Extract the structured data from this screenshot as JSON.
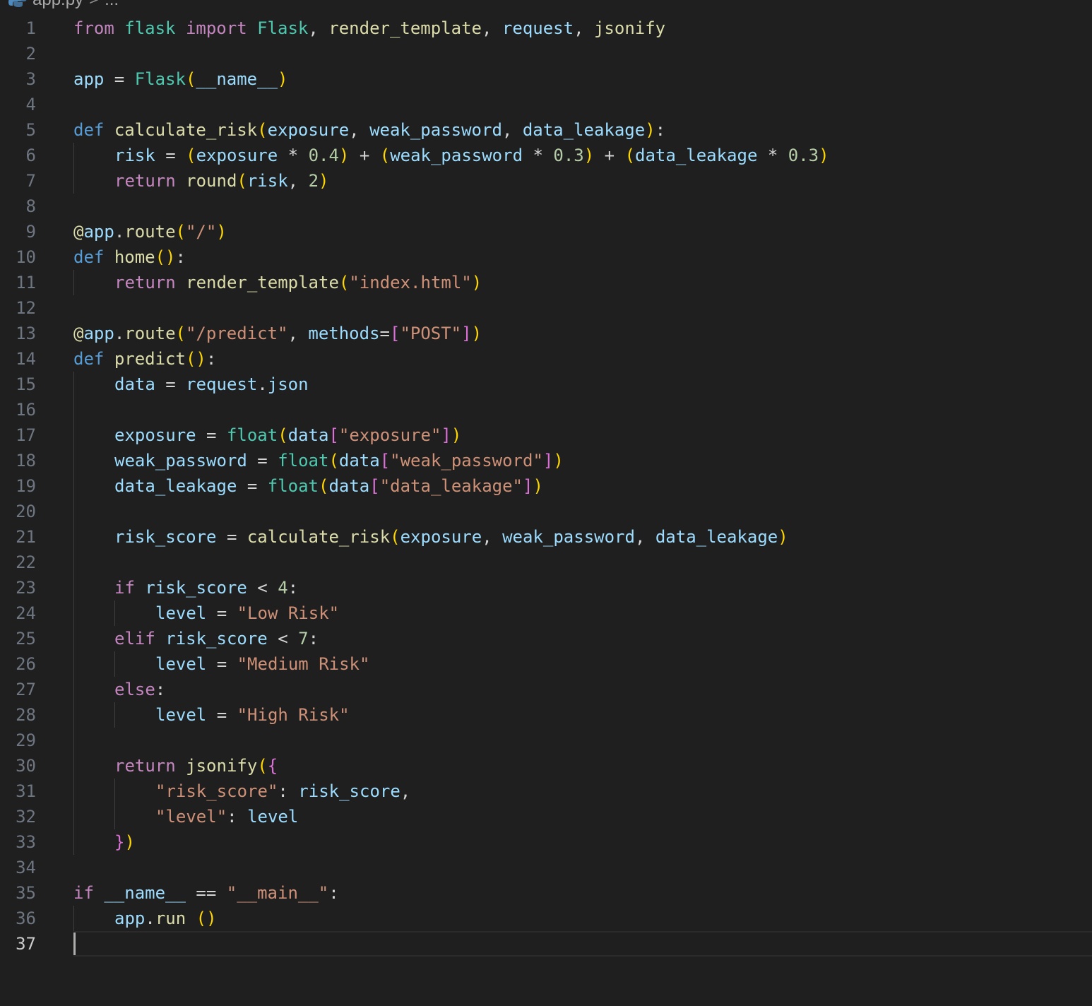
{
  "breadcrumb": {
    "file": "app.py",
    "separator": ">",
    "more": "..."
  },
  "editor": {
    "current_line": 37,
    "lines": [
      {
        "n": "1",
        "indent": 0,
        "tokens": [
          [
            "kw",
            "from"
          ],
          [
            "op",
            " "
          ],
          [
            "cls",
            "flask"
          ],
          [
            "op",
            " "
          ],
          [
            "kw",
            "import"
          ],
          [
            "op",
            " "
          ],
          [
            "cls",
            "Flask"
          ],
          [
            "op",
            ", "
          ],
          [
            "fn",
            "render_template"
          ],
          [
            "op",
            ", "
          ],
          [
            "var",
            "request"
          ],
          [
            "op",
            ", "
          ],
          [
            "fn",
            "jsonify"
          ]
        ]
      },
      {
        "n": "2",
        "indent": 0,
        "tokens": []
      },
      {
        "n": "3",
        "indent": 0,
        "tokens": [
          [
            "var",
            "app"
          ],
          [
            "op",
            " = "
          ],
          [
            "cls",
            "Flask"
          ],
          [
            "b1",
            "("
          ],
          [
            "var",
            "__name__"
          ],
          [
            "b1",
            ")"
          ]
        ]
      },
      {
        "n": "4",
        "indent": 0,
        "tokens": []
      },
      {
        "n": "5",
        "indent": 0,
        "tokens": [
          [
            "def",
            "def"
          ],
          [
            "op",
            " "
          ],
          [
            "fn",
            "calculate_risk"
          ],
          [
            "b1",
            "("
          ],
          [
            "var",
            "exposure"
          ],
          [
            "op",
            ", "
          ],
          [
            "var",
            "weak_password"
          ],
          [
            "op",
            ", "
          ],
          [
            "var",
            "data_leakage"
          ],
          [
            "b1",
            ")"
          ],
          [
            "op",
            ":"
          ]
        ]
      },
      {
        "n": "6",
        "indent": 1,
        "tokens": [
          [
            "var",
            "risk"
          ],
          [
            "op",
            " = "
          ],
          [
            "b1",
            "("
          ],
          [
            "var",
            "exposure"
          ],
          [
            "op",
            " * "
          ],
          [
            "num",
            "0.4"
          ],
          [
            "b1",
            ")"
          ],
          [
            "op",
            " + "
          ],
          [
            "b1",
            "("
          ],
          [
            "var",
            "weak_password"
          ],
          [
            "op",
            " * "
          ],
          [
            "num",
            "0.3"
          ],
          [
            "b1",
            ")"
          ],
          [
            "op",
            " + "
          ],
          [
            "b1",
            "("
          ],
          [
            "var",
            "data_leakage"
          ],
          [
            "op",
            " * "
          ],
          [
            "num",
            "0.3"
          ],
          [
            "b1",
            ")"
          ]
        ]
      },
      {
        "n": "7",
        "indent": 1,
        "tokens": [
          [
            "kw",
            "return"
          ],
          [
            "op",
            " "
          ],
          [
            "fn",
            "round"
          ],
          [
            "b1",
            "("
          ],
          [
            "var",
            "risk"
          ],
          [
            "op",
            ", "
          ],
          [
            "num",
            "2"
          ],
          [
            "b1",
            ")"
          ]
        ]
      },
      {
        "n": "8",
        "indent": 0,
        "tokens": []
      },
      {
        "n": "9",
        "indent": 0,
        "tokens": [
          [
            "fn",
            "@"
          ],
          [
            "var",
            "app"
          ],
          [
            "op",
            "."
          ],
          [
            "fn",
            "route"
          ],
          [
            "b1",
            "("
          ],
          [
            "str",
            "\"/\""
          ],
          [
            "b1",
            ")"
          ]
        ]
      },
      {
        "n": "10",
        "indent": 0,
        "tokens": [
          [
            "def",
            "def"
          ],
          [
            "op",
            " "
          ],
          [
            "fn",
            "home"
          ],
          [
            "b1",
            "()"
          ],
          [
            "op",
            ":"
          ]
        ]
      },
      {
        "n": "11",
        "indent": 1,
        "tokens": [
          [
            "kw",
            "return"
          ],
          [
            "op",
            " "
          ],
          [
            "fn",
            "render_template"
          ],
          [
            "b1",
            "("
          ],
          [
            "str",
            "\"index.html\""
          ],
          [
            "b1",
            ")"
          ]
        ]
      },
      {
        "n": "12",
        "indent": 0,
        "tokens": []
      },
      {
        "n": "13",
        "indent": 0,
        "tokens": [
          [
            "fn",
            "@"
          ],
          [
            "var",
            "app"
          ],
          [
            "op",
            "."
          ],
          [
            "fn",
            "route"
          ],
          [
            "b1",
            "("
          ],
          [
            "str",
            "\"/predict\""
          ],
          [
            "op",
            ", "
          ],
          [
            "var",
            "methods"
          ],
          [
            "op",
            "="
          ],
          [
            "b2",
            "["
          ],
          [
            "str",
            "\"POST\""
          ],
          [
            "b2",
            "]"
          ],
          [
            "b1",
            ")"
          ]
        ]
      },
      {
        "n": "14",
        "indent": 0,
        "tokens": [
          [
            "def",
            "def"
          ],
          [
            "op",
            " "
          ],
          [
            "fn",
            "predict"
          ],
          [
            "b1",
            "()"
          ],
          [
            "op",
            ":"
          ]
        ]
      },
      {
        "n": "15",
        "indent": 1,
        "tokens": [
          [
            "var",
            "data"
          ],
          [
            "op",
            " = "
          ],
          [
            "var",
            "request"
          ],
          [
            "op",
            "."
          ],
          [
            "var",
            "json"
          ]
        ]
      },
      {
        "n": "16",
        "indent": 1,
        "tokens": []
      },
      {
        "n": "17",
        "indent": 1,
        "tokens": [
          [
            "var",
            "exposure"
          ],
          [
            "op",
            " = "
          ],
          [
            "cls",
            "float"
          ],
          [
            "b1",
            "("
          ],
          [
            "var",
            "data"
          ],
          [
            "b2",
            "["
          ],
          [
            "str",
            "\"exposure\""
          ],
          [
            "b2",
            "]"
          ],
          [
            "b1",
            ")"
          ]
        ]
      },
      {
        "n": "18",
        "indent": 1,
        "tokens": [
          [
            "var",
            "weak_password"
          ],
          [
            "op",
            " = "
          ],
          [
            "cls",
            "float"
          ],
          [
            "b1",
            "("
          ],
          [
            "var",
            "data"
          ],
          [
            "b2",
            "["
          ],
          [
            "str",
            "\"weak_password\""
          ],
          [
            "b2",
            "]"
          ],
          [
            "b1",
            ")"
          ]
        ]
      },
      {
        "n": "19",
        "indent": 1,
        "tokens": [
          [
            "var",
            "data_leakage"
          ],
          [
            "op",
            " = "
          ],
          [
            "cls",
            "float"
          ],
          [
            "b1",
            "("
          ],
          [
            "var",
            "data"
          ],
          [
            "b2",
            "["
          ],
          [
            "str",
            "\"data_leakage\""
          ],
          [
            "b2",
            "]"
          ],
          [
            "b1",
            ")"
          ]
        ]
      },
      {
        "n": "20",
        "indent": 1,
        "tokens": []
      },
      {
        "n": "21",
        "indent": 1,
        "tokens": [
          [
            "var",
            "risk_score"
          ],
          [
            "op",
            " = "
          ],
          [
            "fn",
            "calculate_risk"
          ],
          [
            "b1",
            "("
          ],
          [
            "var",
            "exposure"
          ],
          [
            "op",
            ", "
          ],
          [
            "var",
            "weak_password"
          ],
          [
            "op",
            ", "
          ],
          [
            "var",
            "data_leakage"
          ],
          [
            "b1",
            ")"
          ]
        ]
      },
      {
        "n": "22",
        "indent": 1,
        "tokens": []
      },
      {
        "n": "23",
        "indent": 1,
        "tokens": [
          [
            "kw",
            "if"
          ],
          [
            "op",
            " "
          ],
          [
            "var",
            "risk_score"
          ],
          [
            "op",
            " < "
          ],
          [
            "num",
            "4"
          ],
          [
            "op",
            ":"
          ]
        ]
      },
      {
        "n": "24",
        "indent": 2,
        "tokens": [
          [
            "var",
            "level"
          ],
          [
            "op",
            " = "
          ],
          [
            "str",
            "\"Low Risk\""
          ]
        ]
      },
      {
        "n": "25",
        "indent": 1,
        "tokens": [
          [
            "kw",
            "elif"
          ],
          [
            "op",
            " "
          ],
          [
            "var",
            "risk_score"
          ],
          [
            "op",
            " < "
          ],
          [
            "num",
            "7"
          ],
          [
            "op",
            ":"
          ]
        ]
      },
      {
        "n": "26",
        "indent": 2,
        "tokens": [
          [
            "var",
            "level"
          ],
          [
            "op",
            " = "
          ],
          [
            "str",
            "\"Medium Risk\""
          ]
        ]
      },
      {
        "n": "27",
        "indent": 1,
        "tokens": [
          [
            "kw",
            "else"
          ],
          [
            "op",
            ":"
          ]
        ]
      },
      {
        "n": "28",
        "indent": 2,
        "tokens": [
          [
            "var",
            "level"
          ],
          [
            "op",
            " = "
          ],
          [
            "str",
            "\"High Risk\""
          ]
        ]
      },
      {
        "n": "29",
        "indent": 1,
        "tokens": []
      },
      {
        "n": "30",
        "indent": 1,
        "tokens": [
          [
            "kw",
            "return"
          ],
          [
            "op",
            " "
          ],
          [
            "fn",
            "jsonify"
          ],
          [
            "b1",
            "("
          ],
          [
            "b2",
            "{"
          ]
        ]
      },
      {
        "n": "31",
        "indent": 2,
        "tokens": [
          [
            "str",
            "\"risk_score\""
          ],
          [
            "op",
            ": "
          ],
          [
            "var",
            "risk_score"
          ],
          [
            "op",
            ","
          ]
        ]
      },
      {
        "n": "32",
        "indent": 2,
        "tokens": [
          [
            "str",
            "\"level\""
          ],
          [
            "op",
            ": "
          ],
          [
            "var",
            "level"
          ]
        ]
      },
      {
        "n": "33",
        "indent": 1,
        "tokens": [
          [
            "b2",
            "}"
          ],
          [
            "b1",
            ")"
          ]
        ]
      },
      {
        "n": "34",
        "indent": 0,
        "tokens": []
      },
      {
        "n": "35",
        "indent": 0,
        "tokens": [
          [
            "kw",
            "if"
          ],
          [
            "op",
            " "
          ],
          [
            "var",
            "__name__"
          ],
          [
            "op",
            " == "
          ],
          [
            "str",
            "\"__main__\""
          ],
          [
            "op",
            ":"
          ]
        ]
      },
      {
        "n": "36",
        "indent": 1,
        "tokens": [
          [
            "var",
            "app"
          ],
          [
            "op",
            "."
          ],
          [
            "fn",
            "run"
          ],
          [
            "op",
            " "
          ],
          [
            "b1",
            "()"
          ]
        ]
      },
      {
        "n": "37",
        "indent": 0,
        "tokens": []
      }
    ]
  }
}
